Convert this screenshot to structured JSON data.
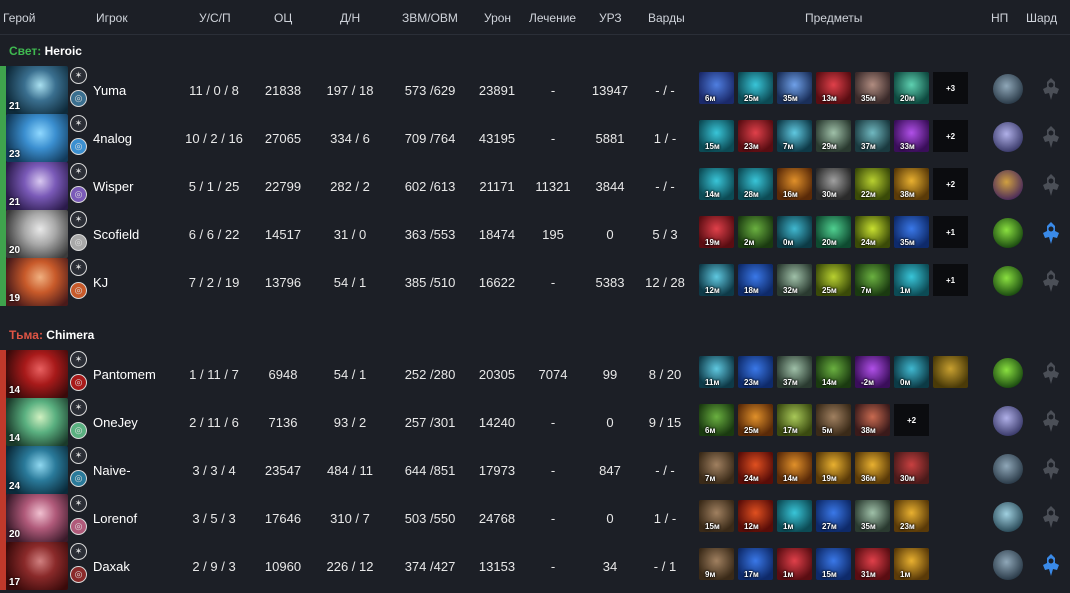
{
  "columns": {
    "hero": "Герой",
    "player": "Игрок",
    "kda": "У/С/П",
    "networth": "ОЦ",
    "lh_dn": "Д/Н",
    "gpm_xpm": "ЗВМ/ОВМ",
    "damage": "Урон",
    "healing": "Лечение",
    "building_damage": "УРЗ",
    "wards": "Варды",
    "items": "Предметы",
    "neutral": "НП",
    "shard": "Шард"
  },
  "radiant": {
    "side_label": "Свет:",
    "team_name": "Heroic",
    "color": "#3fa34d",
    "players": [
      {
        "level": "21",
        "name": "Yuma",
        "kda": "11 / 0 / 8",
        "networth": "21838",
        "lh_dn": "197 / 18",
        "gpm_xpm": "573 /629",
        "damage": "23891",
        "healing": "-",
        "building": "13947",
        "wards": "- / -",
        "portrait": [
          "#0e2a3a",
          "#3a6f8f",
          "#a9e0f0"
        ],
        "items": [
          {
            "t": "6м",
            "c": [
              "#1b2a6b",
              "#4f7ee0"
            ]
          },
          {
            "t": "25м",
            "c": [
              "#0c4b55",
              "#39c5d8"
            ]
          },
          {
            "t": "35м",
            "c": [
              "#1a2f5a",
              "#6fa0e8"
            ]
          },
          {
            "t": "13м",
            "c": [
              "#5a0d12",
              "#e0404a"
            ]
          },
          {
            "t": "35м",
            "c": [
              "#3a2a2a",
              "#b08c80"
            ]
          },
          {
            "t": "20м",
            "c": [
              "#0e4a40",
              "#5ed0b0"
            ]
          }
        ],
        "more": "+3",
        "np": [
          "#2a3a48",
          "#8fa7b8"
        ],
        "shard": "#4b4f57"
      },
      {
        "level": "23",
        "name": "4nalog",
        "kda": "10 / 2 / 16",
        "networth": "27065",
        "lh_dn": "334 / 6",
        "gpm_xpm": "709 /764",
        "damage": "43195",
        "healing": "-",
        "building": "5881",
        "wards": "1 / -",
        "portrait": [
          "#123a5a",
          "#3b8fd0",
          "#8fd8ff"
        ],
        "items": [
          {
            "t": "15м",
            "c": [
              "#0c4b55",
              "#39c5d8"
            ]
          },
          {
            "t": "23м",
            "c": [
              "#5a0d12",
              "#e0404a"
            ]
          },
          {
            "t": "7м",
            "c": [
              "#0e3a48",
              "#5fc8e0"
            ]
          },
          {
            "t": "29м",
            "c": [
              "#2a3a30",
              "#9fc0a8"
            ]
          },
          {
            "t": "37м",
            "c": [
              "#1a3a40",
              "#70b8c0"
            ]
          },
          {
            "t": "33м",
            "c": [
              "#3a0e5a",
              "#b050e8"
            ]
          }
        ],
        "more": "+2",
        "np": [
          "#3a3a6a",
          "#b0b0e8"
        ],
        "shard": "#4b4f57"
      },
      {
        "level": "21",
        "name": "Wisper",
        "kda": "5 / 1 / 25",
        "networth": "22799",
        "lh_dn": "282 / 2",
        "gpm_xpm": "602 /613",
        "damage": "21171",
        "healing": "11321",
        "building": "3844",
        "wards": "- / -",
        "portrait": [
          "#2a1a4a",
          "#7a5ab8",
          "#d8c8f0"
        ],
        "items": [
          {
            "t": "14м",
            "c": [
              "#0c4b55",
              "#39c5d8"
            ]
          },
          {
            "t": "28м",
            "c": [
              "#0c4b55",
              "#39c5d8"
            ]
          },
          {
            "t": "16м",
            "c": [
              "#5a2a08",
              "#e0902a"
            ]
          },
          {
            "t": "30м",
            "c": [
              "#2a2a2a",
              "#a0a0a0"
            ]
          },
          {
            "t": "22м",
            "c": [
              "#3a4a08",
              "#b8d030"
            ]
          },
          {
            "t": "38м",
            "c": [
              "#5a3a08",
              "#e8b030"
            ]
          }
        ],
        "more": "+2",
        "np": [
          "#4a2a5a",
          "#d0a040"
        ],
        "shard": "#4b4f57"
      },
      {
        "level": "20",
        "name": "Scofield",
        "kda": "6 / 6 / 22",
        "networth": "14517",
        "lh_dn": "31 / 0",
        "gpm_xpm": "363 /553",
        "damage": "18474",
        "healing": "195",
        "building": "0",
        "wards": "5 / 3",
        "portrait": [
          "#3a3a3a",
          "#a8a8a8",
          "#e8e8e8"
        ],
        "items": [
          {
            "t": "19м",
            "c": [
              "#5a0d12",
              "#e0404a"
            ]
          },
          {
            "t": "2м",
            "c": [
              "#1a3a10",
              "#6ab040"
            ]
          },
          {
            "t": "0м",
            "c": [
              "#0c3a45",
              "#40b8d0"
            ]
          },
          {
            "t": "20м",
            "c": [
              "#0e4a30",
              "#50d090"
            ]
          },
          {
            "t": "24м",
            "c": [
              "#3a4a08",
              "#c8e030"
            ]
          },
          {
            "t": "35м",
            "c": [
              "#0e2a6a",
              "#3a78e8"
            ]
          }
        ],
        "more": "+1",
        "np": [
          "#1a4a10",
          "#8ae040"
        ],
        "shard": "#3a8ae8"
      },
      {
        "level": "19",
        "name": "KJ",
        "kda": "7 / 2 / 19",
        "networth": "13796",
        "lh_dn": "54 / 1",
        "gpm_xpm": "385 /510",
        "damage": "16622",
        "healing": "-",
        "building": "5383",
        "wards": "12 / 28",
        "portrait": [
          "#4a1a1a",
          "#c85a2a",
          "#f0b080"
        ],
        "items": [
          {
            "t": "12м",
            "c": [
              "#0e3a48",
              "#5fc8e0"
            ]
          },
          {
            "t": "18м",
            "c": [
              "#0e2a6a",
              "#3a78e8"
            ]
          },
          {
            "t": "32м",
            "c": [
              "#2a3a30",
              "#9fc0a8"
            ]
          },
          {
            "t": "25м",
            "c": [
              "#3a4a08",
              "#b8d030"
            ]
          },
          {
            "t": "7м",
            "c": [
              "#1a3a10",
              "#6ab040"
            ]
          },
          {
            "t": "1м",
            "c": [
              "#0c4b55",
              "#39c5d8"
            ]
          }
        ],
        "more": "+1",
        "np": [
          "#1a4a10",
          "#8ae040"
        ],
        "shard": "#4b4f57"
      }
    ]
  },
  "dire": {
    "side_label": "Тьма:",
    "team_name": "Chimera",
    "color": "#c0392b",
    "players": [
      {
        "level": "14",
        "name": "Pantomem",
        "kda": "1 / 11 / 7",
        "networth": "6948",
        "lh_dn": "54 / 1",
        "gpm_xpm": "252 /280",
        "damage": "20305",
        "healing": "7074",
        "building": "99",
        "wards": "8 / 20",
        "portrait": [
          "#3a0a0a",
          "#a81a1a",
          "#e86060"
        ],
        "items": [
          {
            "t": "11м",
            "c": [
              "#0e3a48",
              "#5fc8e0"
            ]
          },
          {
            "t": "23м",
            "c": [
              "#0e2a6a",
              "#3a78e8"
            ]
          },
          {
            "t": "37м",
            "c": [
              "#2a3a30",
              "#9fc0a8"
            ]
          },
          {
            "t": "14м",
            "c": [
              "#1a3a10",
              "#6ab040"
            ]
          },
          {
            "t": "-2м",
            "c": [
              "#3a0e5a",
              "#b050e8"
            ]
          },
          {
            "t": "0м",
            "c": [
              "#0c3a45",
              "#40b8d0"
            ]
          },
          {
            "t": "",
            "c": [
              "#4a3a08",
              "#c8a030"
            ]
          }
        ],
        "more": "",
        "np": [
          "#1a4a10",
          "#8ae040"
        ],
        "shard": "#4b4f57"
      },
      {
        "level": "14",
        "name": "OneJey",
        "kda": "2 / 11 / 6",
        "networth": "7136",
        "lh_dn": "93 / 2",
        "gpm_xpm": "257 /301",
        "damage": "14240",
        "healing": "-",
        "building": "0",
        "wards": "9 / 15",
        "portrait": [
          "#1a3a2a",
          "#5ab080",
          "#d0f0c0"
        ],
        "items": [
          {
            "t": "6м",
            "c": [
              "#1a3a10",
              "#6ab040"
            ]
          },
          {
            "t": "25м",
            "c": [
              "#5a2a08",
              "#e0902a"
            ]
          },
          {
            "t": "17м",
            "c": [
              "#3a4a10",
              "#a8c858"
            ]
          },
          {
            "t": "5м",
            "c": [
              "#3a2a18",
              "#a08060"
            ]
          },
          {
            "t": "38м",
            "c": [
              "#3a1a1a",
              "#c86a50"
            ]
          }
        ],
        "more": "+2",
        "np": [
          "#3a3a6a",
          "#b0b0e8"
        ],
        "shard": "#4b4f57"
      },
      {
        "level": "24",
        "name": "Naive-",
        "kda": "3 / 3 / 4",
        "networth": "23547",
        "lh_dn": "484 / 11",
        "gpm_xpm": "644 /851",
        "damage": "17973",
        "healing": "-",
        "building": "847",
        "wards": "- / -",
        "portrait": [
          "#0a2a3a",
          "#2a7a9a",
          "#90d8f0"
        ],
        "items": [
          {
            "t": "7м",
            "c": [
              "#3a2a18",
              "#a08060"
            ]
          },
          {
            "t": "24м",
            "c": [
              "#5a0d08",
              "#e05020"
            ]
          },
          {
            "t": "14м",
            "c": [
              "#5a2a08",
              "#e0902a"
            ]
          },
          {
            "t": "19м",
            "c": [
              "#5a3a08",
              "#e8b030"
            ]
          },
          {
            "t": "36м",
            "c": [
              "#5a3a08",
              "#e8b030"
            ]
          },
          {
            "t": "30м",
            "c": [
              "#4a1a1a",
              "#c84040"
            ]
          }
        ],
        "more": "",
        "np": [
          "#2a3a48",
          "#8fa7b8"
        ],
        "shard": "#4b4f57"
      },
      {
        "level": "20",
        "name": "Lorenof",
        "kda": "3 / 5 / 3",
        "networth": "17646",
        "lh_dn": "310 / 7",
        "gpm_xpm": "503 /550",
        "damage": "24768",
        "healing": "-",
        "building": "0",
        "wards": "1 / -",
        "portrait": [
          "#3a1a2a",
          "#b05a7a",
          "#f0c0d0"
        ],
        "items": [
          {
            "t": "15м",
            "c": [
              "#3a2a18",
              "#a08060"
            ]
          },
          {
            "t": "12м",
            "c": [
              "#5a0d08",
              "#e05020"
            ]
          },
          {
            "t": "1м",
            "c": [
              "#0c4b55",
              "#39c5d8"
            ]
          },
          {
            "t": "27м",
            "c": [
              "#0e2a6a",
              "#3a78e8"
            ]
          },
          {
            "t": "35м",
            "c": [
              "#2a3a30",
              "#9fc0a8"
            ]
          },
          {
            "t": "23м",
            "c": [
              "#5a3a08",
              "#e8b030"
            ]
          }
        ],
        "more": "",
        "np": [
          "#2a4a58",
          "#a0d0e0"
        ],
        "shard": "#4b4f57"
      },
      {
        "level": "17",
        "name": "Daxak",
        "kda": "2 / 9 / 3",
        "networth": "10960",
        "lh_dn": "226 / 12",
        "gpm_xpm": "374 /427",
        "damage": "13153",
        "healing": "-",
        "building": "34",
        "wards": "- / 1",
        "portrait": [
          "#3a0a0a",
          "#8a2a2a",
          "#d08080"
        ],
        "items": [
          {
            "t": "9м",
            "c": [
              "#3a2a18",
              "#a08060"
            ]
          },
          {
            "t": "17м",
            "c": [
              "#0e2a6a",
              "#3a78e8"
            ]
          },
          {
            "t": "1м",
            "c": [
              "#5a0d12",
              "#e0404a"
            ]
          },
          {
            "t": "15м",
            "c": [
              "#0e2a6a",
              "#3a78e8"
            ]
          },
          {
            "t": "31м",
            "c": [
              "#5a0d12",
              "#e0404a"
            ]
          },
          {
            "t": "1м",
            "c": [
              "#5a3a08",
              "#e8b030"
            ]
          }
        ],
        "more": "",
        "np": [
          "#2a3a48",
          "#8fa7b8"
        ],
        "shard": "#3a8ae8"
      }
    ]
  }
}
